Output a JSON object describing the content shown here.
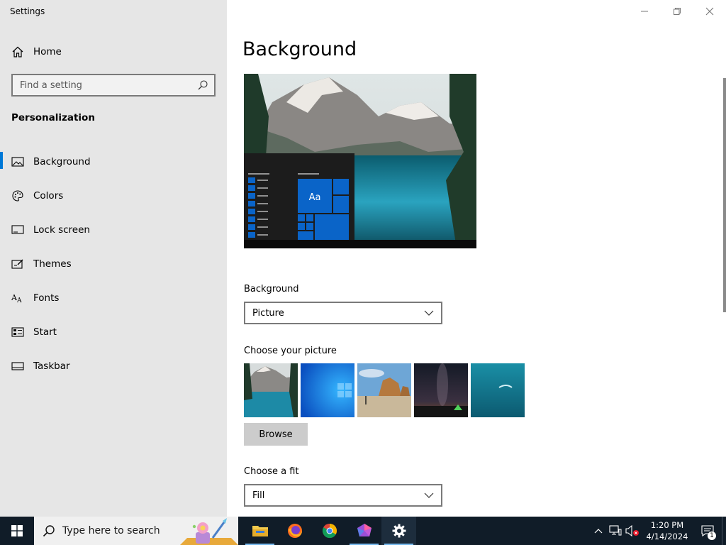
{
  "window": {
    "title": "Settings"
  },
  "sidebar": {
    "home_label": "Home",
    "search_placeholder": "Find a setting",
    "section_heading": "Personalization",
    "items": [
      {
        "label": "Background",
        "icon": "picture-icon",
        "active": true
      },
      {
        "label": "Colors",
        "icon": "palette-icon"
      },
      {
        "label": "Lock screen",
        "icon": "lock-screen-icon"
      },
      {
        "label": "Themes",
        "icon": "themes-icon"
      },
      {
        "label": "Fonts",
        "icon": "fonts-icon"
      },
      {
        "label": "Start",
        "icon": "start-icon"
      },
      {
        "label": "Taskbar",
        "icon": "taskbar-icon"
      }
    ]
  },
  "main": {
    "page_title": "Background",
    "preview_tile_text": "Aa",
    "background_label": "Background",
    "background_value": "Picture",
    "choose_picture_label": "Choose your picture",
    "browse_label": "Browse",
    "choose_fit_label": "Choose a fit",
    "fit_value": "Fill"
  },
  "taskbar": {
    "search_placeholder": "Type here to search",
    "apps": [
      "File Explorer",
      "Firefox",
      "Chrome",
      "App",
      "Settings"
    ],
    "clock_time": "1:20 PM",
    "clock_date": "4/14/2024",
    "notification_count": "1"
  },
  "colors": {
    "accent": "#0078d7",
    "sidebar_bg": "#e6e6e6",
    "taskbar_bg": "#101c28"
  }
}
